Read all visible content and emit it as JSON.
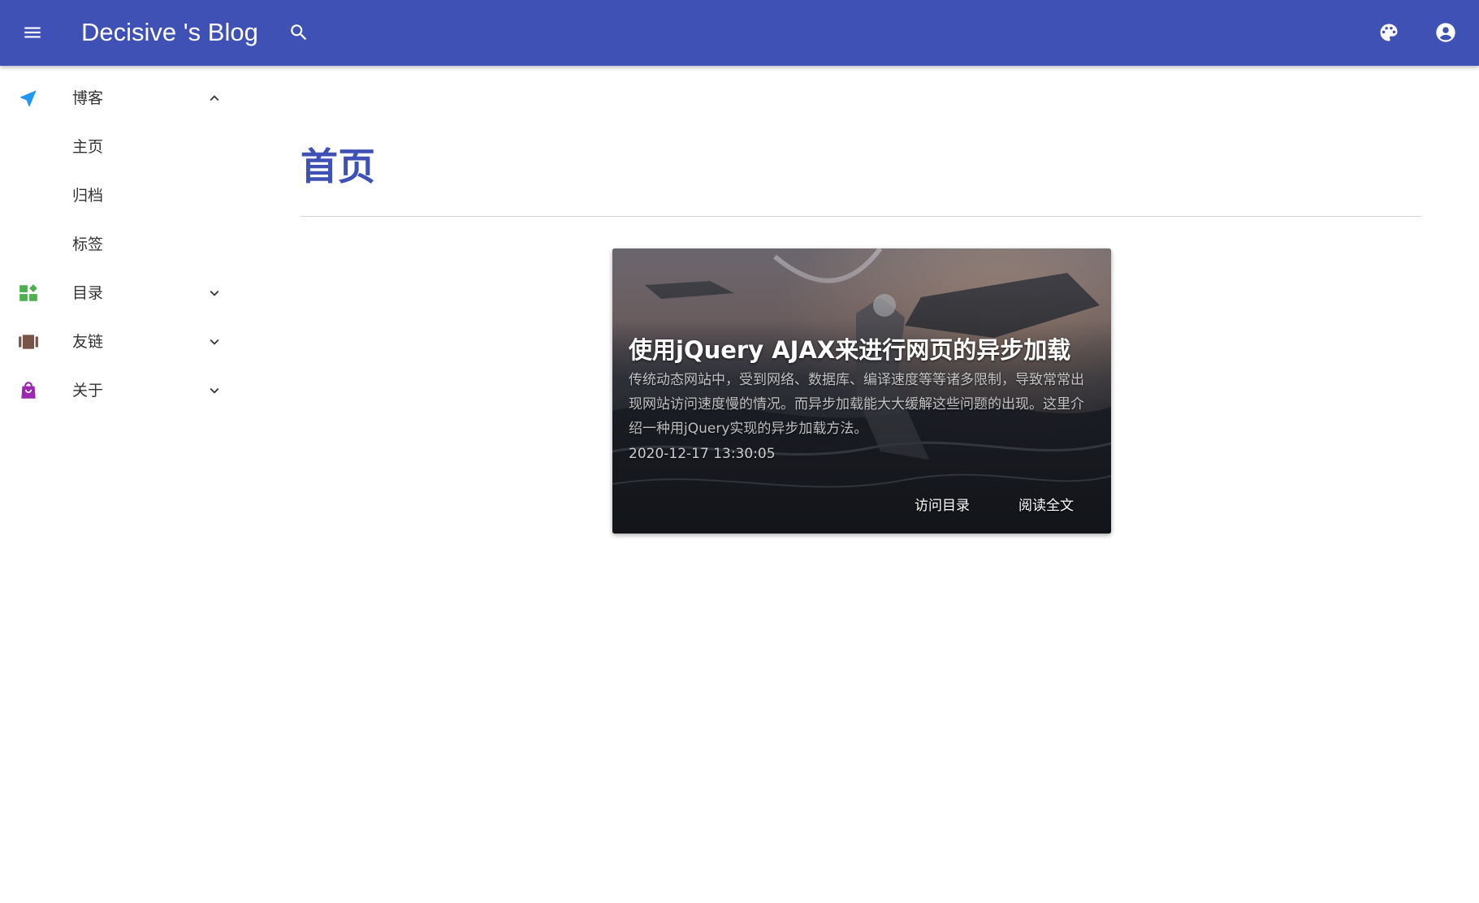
{
  "header": {
    "title": "Decisive 's Blog",
    "bar_color": "#3f51b5",
    "icons": [
      "menu-icon",
      "search-icon",
      "palette-icon",
      "account-circle-icon"
    ]
  },
  "sidebar": {
    "items": [
      {
        "label": "博客",
        "icon": "navigation-icon",
        "icon_color": "#2196f3",
        "expanded": true,
        "children": [
          {
            "label": "主页"
          },
          {
            "label": "归档"
          },
          {
            "label": "标签"
          }
        ]
      },
      {
        "label": "目录",
        "icon": "dashboard-icon",
        "icon_color": "#4caf50",
        "expanded": false
      },
      {
        "label": "友链",
        "icon": "view-array-icon",
        "icon_color": "#795548",
        "expanded": false
      },
      {
        "label": "关于",
        "icon": "shopping-bag-icon",
        "icon_color": "#9c27b0",
        "expanded": false
      }
    ]
  },
  "main": {
    "page_title": "首页",
    "title_color": "#3f51b5",
    "posts": [
      {
        "title": "使用jQuery AJAX来进行网页的异步加载",
        "excerpt": "传统动态网站中，受到网络、数据库、编译速度等等诸多限制，导致常常出现网站访问速度慢的情况。而异步加载能大大缓解这些问题的出现。这里介绍一种用jQuery实现的异步加载方法。",
        "date": "2020-12-17 13:30:05",
        "actions": {
          "toc": "访问目录",
          "read": "阅读全文"
        }
      }
    ]
  }
}
